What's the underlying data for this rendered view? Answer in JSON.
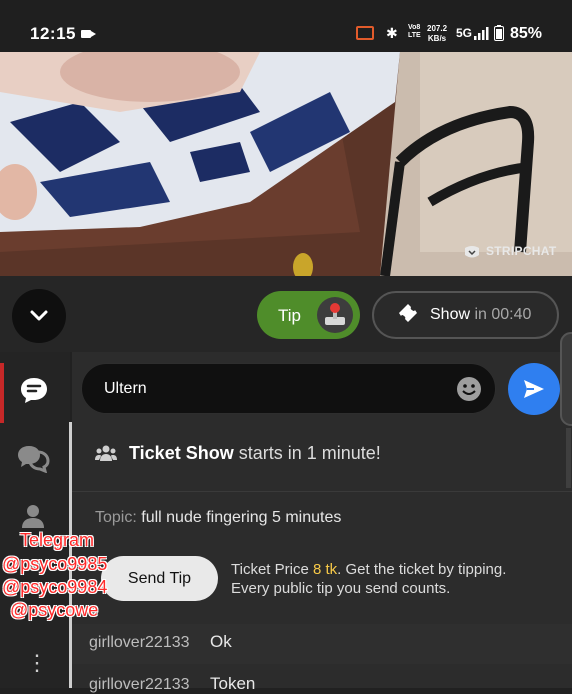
{
  "status_bar": {
    "time": "12:15",
    "network_type_top": "Vo8",
    "network_type_bottom": "LTE",
    "speed_value": "207.2",
    "speed_unit": "KB/s",
    "network": "5G",
    "battery": "85%"
  },
  "video": {
    "watermark": "STRIPCHAT"
  },
  "controls": {
    "tip_label": "Tip",
    "show_label": "Show",
    "show_countdown": "in 00:40"
  },
  "chat": {
    "input_value": "Ultern",
    "ticket_show": {
      "title_bold": "Ticket Show",
      "title_rest": "starts in 1 minute!",
      "topic_label": "Topic:",
      "topic_value": "full nude fingering 5 minutes",
      "send_tip_label": "Send Tip",
      "price_prefix": "Ticket Price",
      "price_value": "8 tk",
      "price_suffix": ". Get the ticket by tipping.",
      "price_line2": "Every public tip you send counts."
    },
    "messages": [
      {
        "user": "girllover22133",
        "text": "Ok"
      },
      {
        "user": "girllover22133",
        "text": "Token"
      }
    ]
  },
  "overlay": {
    "line1": "Telegram",
    "line2": "@psyco9985",
    "line3": "@psyco9984",
    "line4": "@psycowe"
  },
  "colors": {
    "tip_green": "#4f8d2a",
    "send_blue": "#2f7ff0",
    "active_red": "#c62828",
    "price_yellow": "#f7c948"
  }
}
